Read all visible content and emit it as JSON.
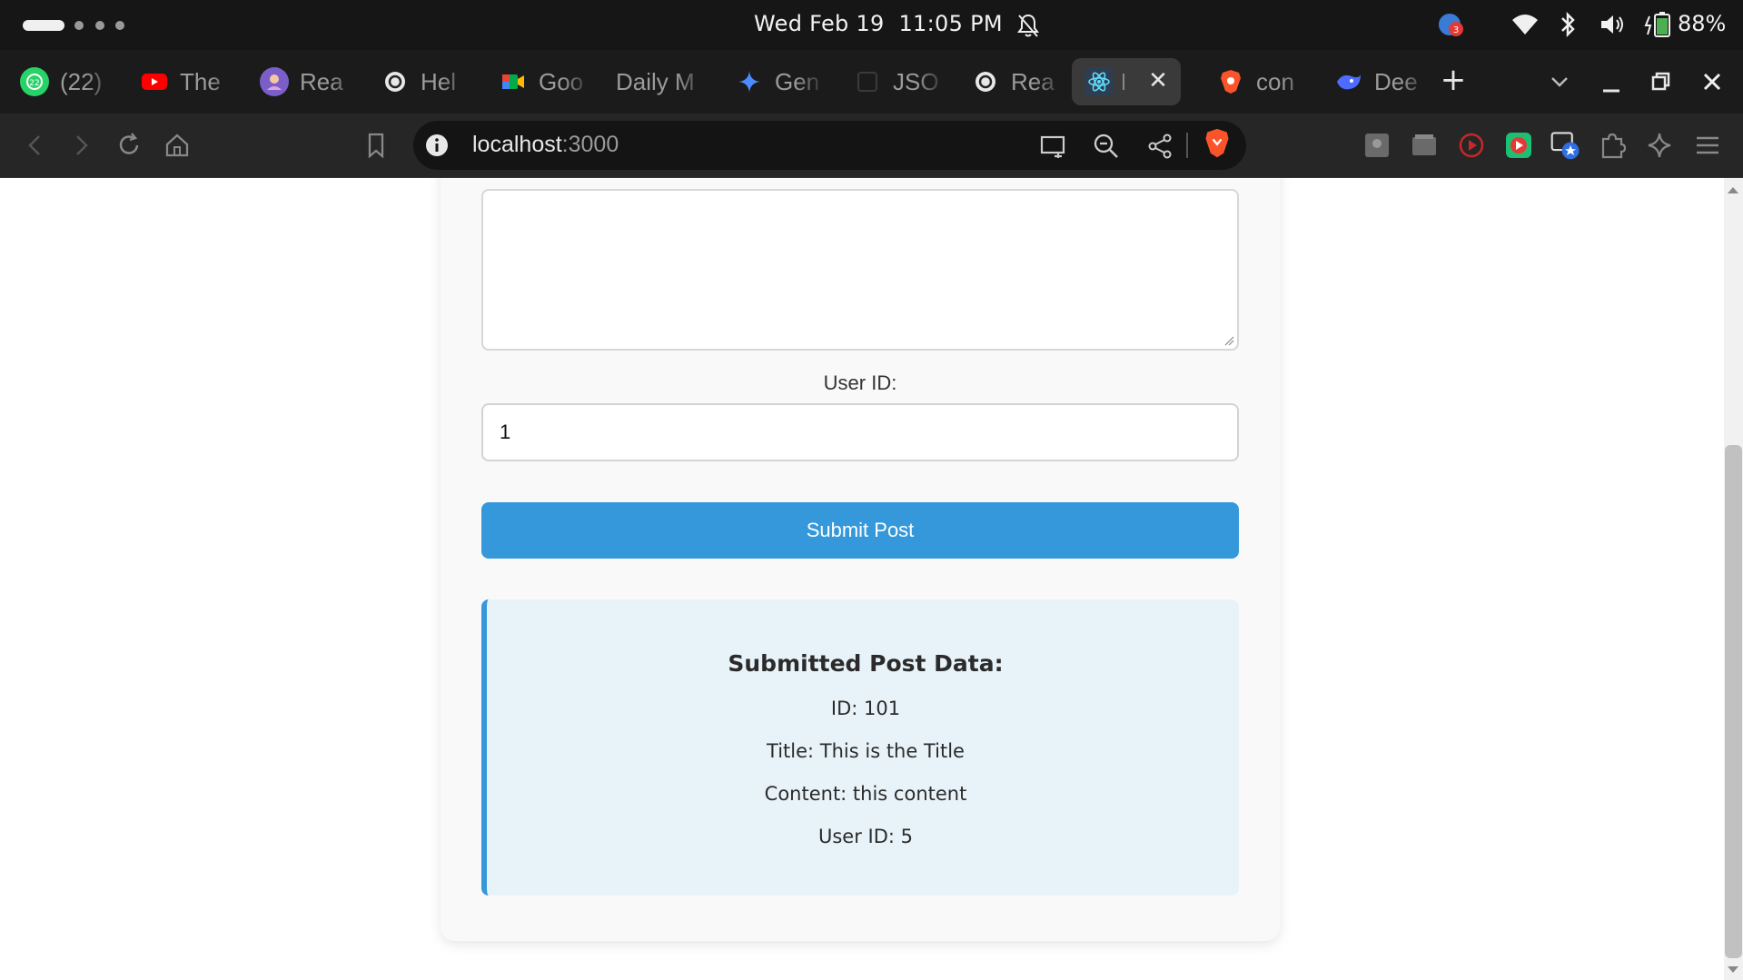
{
  "os": {
    "datetime": "Wed Feb 19  11:05 PM",
    "battery": "88%",
    "notification_badge": "3"
  },
  "tabs": [
    {
      "label": "(22)",
      "icon": "whatsapp-icon",
      "color": "#25d366"
    },
    {
      "label": "The",
      "icon": "youtube-icon",
      "color": "#ff0000"
    },
    {
      "label": "Rea",
      "icon": "avatar-icon",
      "color": "#9b59b6"
    },
    {
      "label": "Hel",
      "icon": "openai-icon",
      "color": "#e0e0e0"
    },
    {
      "label": "Goo",
      "icon": "google-meet-icon",
      "color": "#00ac47"
    },
    {
      "label": "Daily M",
      "icon": "",
      "color": ""
    },
    {
      "label": "Gen",
      "icon": "gemini-icon",
      "color": "#4a8cff"
    },
    {
      "label": "JSO",
      "icon": "json-icon",
      "color": "#333333"
    },
    {
      "label": "Rea",
      "icon": "openai-icon",
      "color": "#e0e0e0"
    },
    {
      "label": "",
      "icon": "react-icon",
      "color": "#61dafb",
      "active": true
    },
    {
      "label": "con",
      "icon": "brave-icon",
      "color": "#fb542b"
    },
    {
      "label": "Dee",
      "icon": "deepseek-icon",
      "color": "#4d6bfe"
    }
  ],
  "address_bar": {
    "host": "localhost",
    "port": ":3000"
  },
  "form": {
    "user_id_label": "User ID:",
    "user_id_value": "1",
    "submit_label": "Submit Post"
  },
  "result": {
    "title": "Submitted Post Data:",
    "id_line": "ID: 101",
    "title_line": "Title: This is the Title",
    "content_line": "Content: this content",
    "user_line": "User ID: 5"
  },
  "colors": {
    "accent": "#3498db",
    "result_bg": "#e8f3f9"
  }
}
